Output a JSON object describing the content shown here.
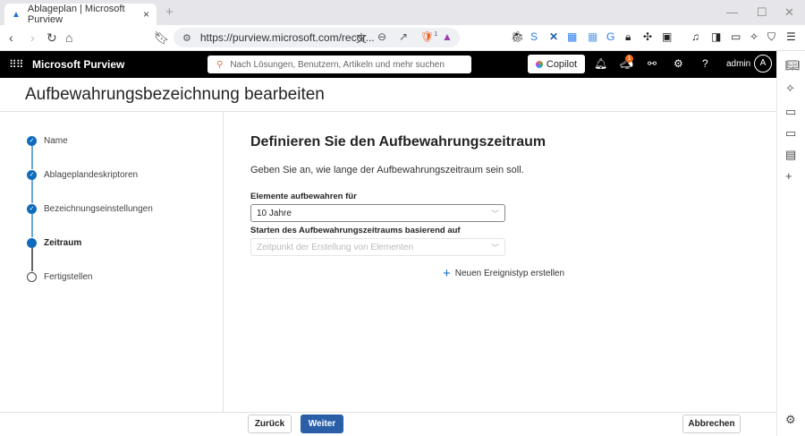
{
  "browser": {
    "tab_title": "Ablageplan | Microsoft Purview",
    "url": "https://purview.microsoft.com/recor...",
    "shield_count": "1"
  },
  "header": {
    "brand": "Microsoft Purview",
    "search_placeholder": "Nach Lösungen, Benutzern, Artikeln und mehr suchen",
    "copilot": "Copilot",
    "notification_count": "1",
    "user": "admin",
    "avatar": "A"
  },
  "page": {
    "title": "Aufbewahrungsbezeichnung bearbeiten"
  },
  "steps": [
    {
      "label": "Name",
      "state": "done"
    },
    {
      "label": "Ablageplandeskriptoren",
      "state": "done"
    },
    {
      "label": "Bezeichnungseinstellungen",
      "state": "done"
    },
    {
      "label": "Zeitraum",
      "state": "current"
    },
    {
      "label": "Fertigstellen",
      "state": "pending"
    }
  ],
  "form": {
    "heading": "Definieren Sie den Aufbewahrungszeitraum",
    "description": "Geben Sie an, wie lange der Aufbewahrungszeitraum sein soll.",
    "retain_label": "Elemente aufbewahren für",
    "retain_value": "10 Jahre",
    "start_label": "Starten des Aufbewahrungszeitraums basierend auf",
    "start_value": "Zeitpunkt der Erstellung von Elementen",
    "new_event": "Neuen Ereignistyp erstellen"
  },
  "footer": {
    "back": "Zurück",
    "next": "Weiter",
    "cancel": "Abbrechen"
  }
}
